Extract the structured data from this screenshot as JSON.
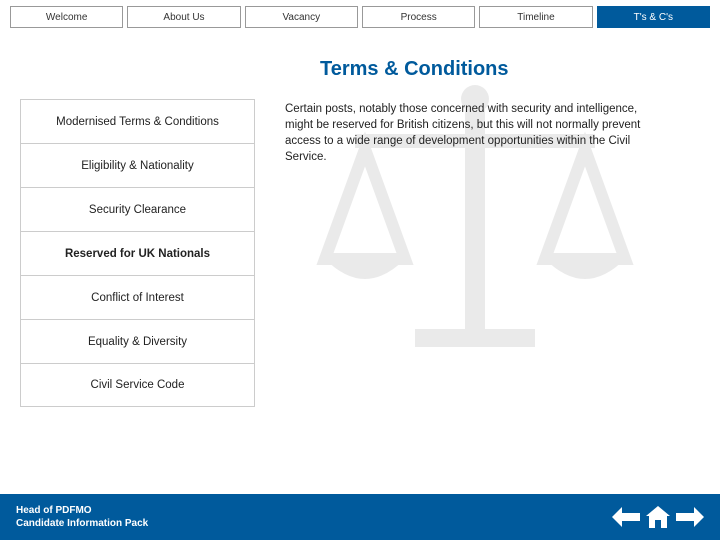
{
  "topnav": {
    "tabs": [
      {
        "label": "Welcome",
        "active": false
      },
      {
        "label": "About Us",
        "active": false
      },
      {
        "label": "Vacancy",
        "active": false
      },
      {
        "label": "Process",
        "active": false
      },
      {
        "label": "Timeline",
        "active": false
      },
      {
        "label": "T's & C's",
        "active": true
      }
    ]
  },
  "page_title": "Terms & Conditions",
  "sidebar": {
    "items": [
      {
        "label": "Modernised Terms & Conditions",
        "active": false
      },
      {
        "label": "Eligibility & Nationality",
        "active": false
      },
      {
        "label": "Security Clearance",
        "active": false
      },
      {
        "label": "Reserved for UK Nationals",
        "active": true
      },
      {
        "label": "Conflict of Interest",
        "active": false
      },
      {
        "label": "Equality & Diversity",
        "active": false
      },
      {
        "label": "Civil Service Code",
        "active": false
      }
    ]
  },
  "body_text": "Certain posts, notably those concerned with security and intelligence, might be reserved for British citizens, but this will not normally prevent access to a wide range of development opportunities within the Civil Service.",
  "footer": {
    "line1": "Head of PDFMO",
    "line2": "Candidate Information Pack"
  },
  "colors": {
    "brand": "#005a9c"
  }
}
